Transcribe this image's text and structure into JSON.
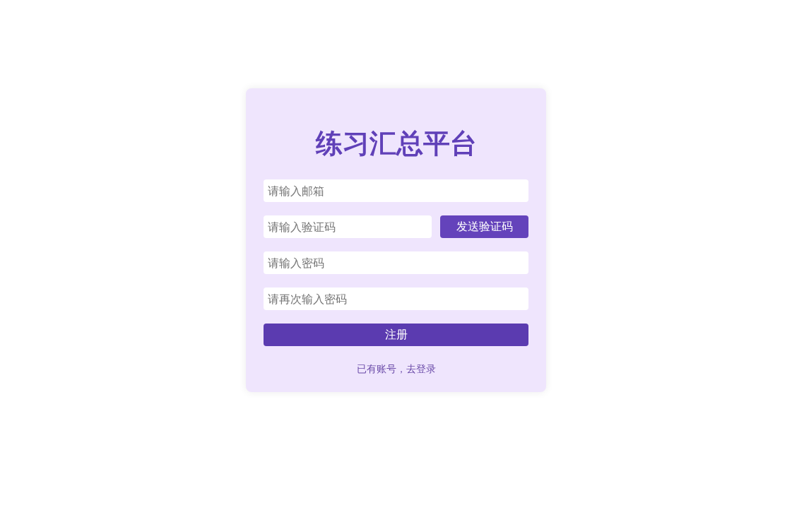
{
  "title": "练习汇总平台",
  "fields": [
    {
      "placeholder": "请输入邮箱"
    },
    {
      "placeholder": "请输入验证码",
      "button": "发送验证码"
    },
    {
      "placeholder": "请输入密码"
    },
    {
      "placeholder": "请再次输入密码"
    }
  ],
  "submit": "注册",
  "login_link": "已有账号，去登录"
}
